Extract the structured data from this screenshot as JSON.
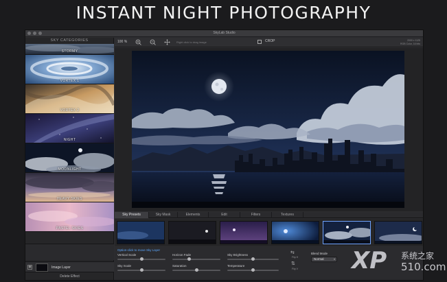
{
  "headline": "INSTANT NIGHT PHOTOGRAPHY",
  "window": {
    "title": "SkyLab Studio"
  },
  "sidebar": {
    "header": "SKY CATEGORIES",
    "categories": [
      {
        "label": "STORMY"
      },
      {
        "label": "VORTEX 1"
      },
      {
        "label": "VORTEX 2"
      },
      {
        "label": "NIGHT"
      },
      {
        "label": "MOONLIGHT"
      },
      {
        "label": "HEAVY SKIES"
      },
      {
        "label": "PASTEL SKIES"
      }
    ],
    "layer_label": "Image Layer",
    "delete_label": "Delete Effect"
  },
  "toolbar": {
    "zoom": "100 %",
    "hint": "Right click to drag image",
    "crop_label": "CROP",
    "image_size": "2000 x 1125",
    "image_mode": "RGB Color, 16 bits"
  },
  "tabs": [
    {
      "label": "Sky Presets",
      "active": true
    },
    {
      "label": "Sky Mask"
    },
    {
      "label": "Elements"
    },
    {
      "label": "Edit"
    },
    {
      "label": "Filters"
    },
    {
      "label": "Textures"
    }
  ],
  "controls": {
    "title": "Option-click to move Sky Layer",
    "vertical_scale": {
      "label": "Vertical Scale",
      "value": 0.5
    },
    "horizon_fade": {
      "label": "Horizon Fade",
      "value": 0.35
    },
    "sky_brightness": {
      "label": "Sky Brightness",
      "value": 0.5
    },
    "sky_scale": {
      "label": "Sky Scale",
      "value": 0.5
    },
    "saturation": {
      "label": "Saturation",
      "value": 0.5
    },
    "temperature": {
      "label": "Temperature",
      "value": 0.5
    },
    "flip_h": "Flip H",
    "flip_v": "Flip V",
    "blend_mode_label": "Blend Mode",
    "blend_mode_value": "Normal"
  },
  "watermark": {
    "brand": "XP",
    "cn": "系统之家",
    "num": "510.com"
  },
  "colors": {
    "accent": "#5aa7ff",
    "selected_border": "#6fa3ff"
  },
  "icons": {
    "zoom_in": "zoom-in-icon",
    "zoom_out": "zoom-out-icon",
    "move": "move-icon",
    "crop": "crop-icon"
  }
}
